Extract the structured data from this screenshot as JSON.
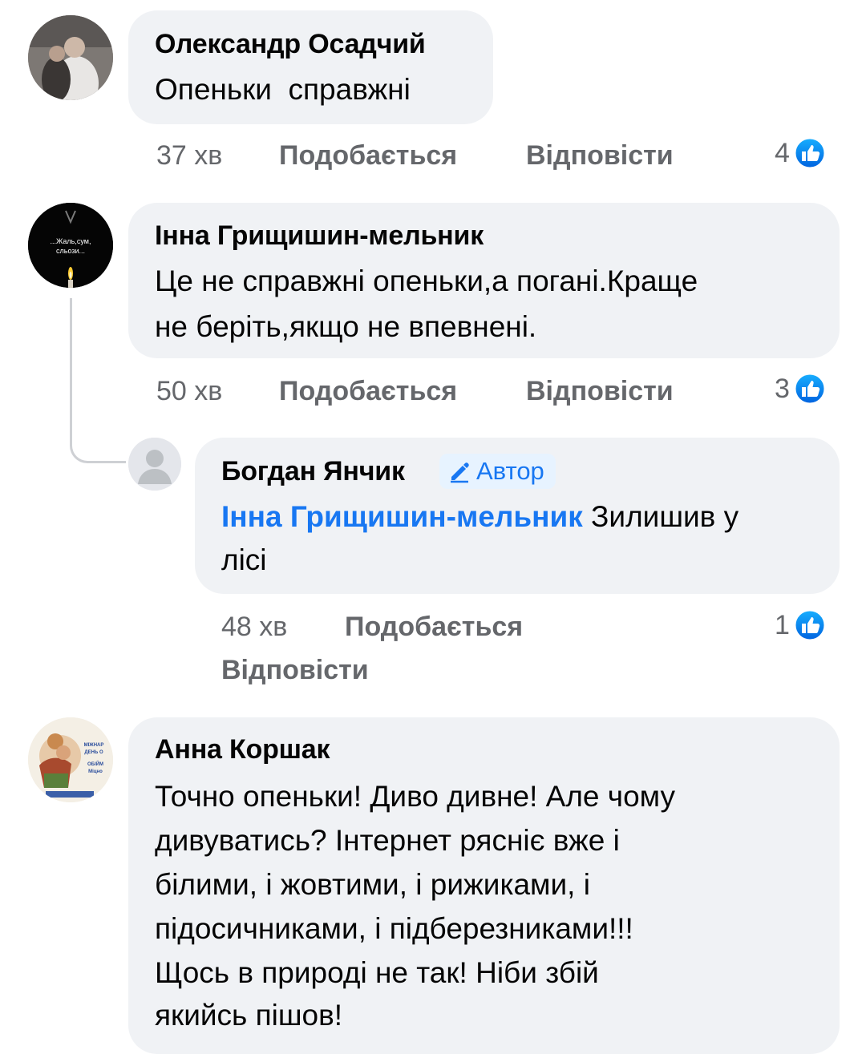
{
  "comments": [
    {
      "author": "Олександр Осадчий",
      "text": "Опеньки  справжні",
      "time": "37 хв",
      "like_label": "Подобається",
      "reply_label": "Відповісти",
      "reaction_count": "4"
    },
    {
      "author": "Інна Грищишин-мельник",
      "text_line1": "Це не справжні опеньки,а погані.Краще",
      "text_line2": "не беріть,якщо не впевнені.",
      "avatar_caption_1": "...Жаль,сум,",
      "avatar_caption_2": "сльози...",
      "time": "50 хв",
      "like_label": "Подобається",
      "reply_label": "Відповісти",
      "reaction_count": "3"
    },
    {
      "author": "Анна Коршак",
      "avatar_caption_1": "МІЖНАР",
      "avatar_caption_2": "ДЕНЬ О",
      "avatar_caption_3": "ОБІЙМ",
      "avatar_caption_4": "Міцно",
      "lines": [
        "Точно опеньки! Диво дивне! Але чому",
        "дивуватись? Інтернет рясніє вже і",
        "білими, і жовтими, і рижиками, і",
        "підосичниками, і підберезниками!!!",
        "Щось в природі не так! Ніби збій",
        "якийсь пішов!"
      ]
    }
  ],
  "reply": {
    "author": "Богдан Янчик",
    "badge_label": "Автор",
    "mention": "Інна Грищишин-мельник",
    "text_rest": " Зилишив у",
    "text_line2": "лісі",
    "time": "48 хв",
    "like_label": "Подобається",
    "reply_label": "Відповісти",
    "reaction_count": "1"
  },
  "colors": {
    "bubble": "#f0f2f5",
    "meta": "#65676b",
    "link": "#1877f2",
    "like_gradient_top": "#18afff",
    "like_gradient_bottom": "#0062df"
  },
  "icons": {
    "reaction": "like-thumb-icon",
    "badge": "pencil-icon",
    "default_avatar": "person-silhouette-icon"
  }
}
